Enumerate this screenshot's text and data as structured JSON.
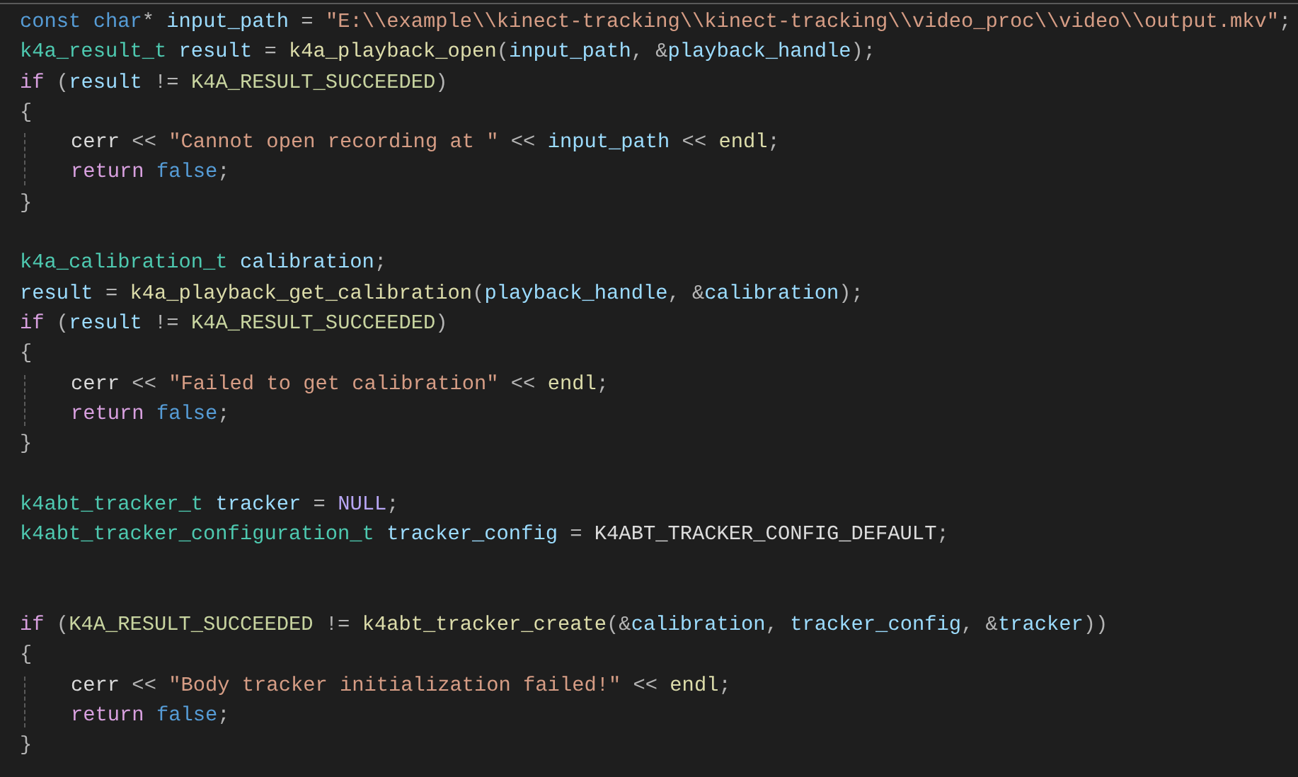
{
  "editor": {
    "lines": [
      {
        "kind": "code",
        "tokens": [
          {
            "text": "const ",
            "kind": "keyword"
          },
          {
            "text": "char",
            "kind": "keyword"
          },
          {
            "text": "* ",
            "kind": "op"
          },
          {
            "text": "input_path",
            "kind": "variable"
          },
          {
            "text": " = ",
            "kind": "op"
          },
          {
            "text": "\"E:\\\\example\\\\kinect-tracking\\\\kinect-tracking\\\\video_proc\\\\video\\\\output.mkv\"",
            "kind": "string"
          },
          {
            "text": ";",
            "kind": "op"
          }
        ]
      },
      {
        "kind": "code",
        "tokens": [
          {
            "text": "k4a_result_t ",
            "kind": "type"
          },
          {
            "text": "result",
            "kind": "variable"
          },
          {
            "text": " = ",
            "kind": "op"
          },
          {
            "text": "k4a_playback_open",
            "kind": "function"
          },
          {
            "text": "(",
            "kind": "op"
          },
          {
            "text": "input_path",
            "kind": "variable"
          },
          {
            "text": ", &",
            "kind": "op"
          },
          {
            "text": "playback_handle",
            "kind": "variable"
          },
          {
            "text": ");",
            "kind": "op"
          }
        ]
      },
      {
        "kind": "code",
        "tokens": [
          {
            "text": "if",
            "kind": "control"
          },
          {
            "text": " (",
            "kind": "op"
          },
          {
            "text": "result",
            "kind": "variable"
          },
          {
            "text": " != ",
            "kind": "op"
          },
          {
            "text": "K4A_RESULT_SUCCEEDED",
            "kind": "macro"
          },
          {
            "text": ")",
            "kind": "op"
          }
        ]
      },
      {
        "kind": "code",
        "tokens": [
          {
            "text": "{",
            "kind": "op"
          }
        ],
        "children": [
          {
            "kind": "code",
            "tokens": [
              {
                "text": "cerr",
                "kind": "identifier"
              },
              {
                "text": " << ",
                "kind": "op"
              },
              {
                "text": "\"Cannot open recording at \"",
                "kind": "string"
              },
              {
                "text": " << ",
                "kind": "op"
              },
              {
                "text": "input_path",
                "kind": "variable"
              },
              {
                "text": " << ",
                "kind": "op"
              },
              {
                "text": "endl",
                "kind": "function"
              },
              {
                "text": ";",
                "kind": "op"
              }
            ]
          },
          {
            "kind": "code",
            "tokens": [
              {
                "text": "return ",
                "kind": "control"
              },
              {
                "text": "false",
                "kind": "keyword"
              },
              {
                "text": ";",
                "kind": "op"
              }
            ]
          }
        ]
      },
      {
        "kind": "code",
        "tokens": [
          {
            "text": "}",
            "kind": "op"
          }
        ]
      },
      {
        "kind": "blank"
      },
      {
        "kind": "code",
        "tokens": [
          {
            "text": "k4a_calibration_t ",
            "kind": "type"
          },
          {
            "text": "calibration",
            "kind": "variable"
          },
          {
            "text": ";",
            "kind": "op"
          }
        ]
      },
      {
        "kind": "code",
        "tokens": [
          {
            "text": "result",
            "kind": "variable"
          },
          {
            "text": " = ",
            "kind": "op"
          },
          {
            "text": "k4a_playback_get_calibration",
            "kind": "function"
          },
          {
            "text": "(",
            "kind": "op"
          },
          {
            "text": "playback_handle",
            "kind": "variable"
          },
          {
            "text": ", &",
            "kind": "op"
          },
          {
            "text": "calibration",
            "kind": "variable"
          },
          {
            "text": ");",
            "kind": "op"
          }
        ]
      },
      {
        "kind": "code",
        "tokens": [
          {
            "text": "if",
            "kind": "control"
          },
          {
            "text": " (",
            "kind": "op"
          },
          {
            "text": "result",
            "kind": "variable"
          },
          {
            "text": " != ",
            "kind": "op"
          },
          {
            "text": "K4A_RESULT_SUCCEEDED",
            "kind": "macro"
          },
          {
            "text": ")",
            "kind": "op"
          }
        ]
      },
      {
        "kind": "code",
        "tokens": [
          {
            "text": "{",
            "kind": "op"
          }
        ],
        "children": [
          {
            "kind": "code",
            "tokens": [
              {
                "text": "cerr",
                "kind": "identifier"
              },
              {
                "text": " << ",
                "kind": "op"
              },
              {
                "text": "\"Failed to get calibration\"",
                "kind": "string"
              },
              {
                "text": " << ",
                "kind": "op"
              },
              {
                "text": "endl",
                "kind": "function"
              },
              {
                "text": ";",
                "kind": "op"
              }
            ]
          },
          {
            "kind": "code",
            "tokens": [
              {
                "text": "return ",
                "kind": "control"
              },
              {
                "text": "false",
                "kind": "keyword"
              },
              {
                "text": ";",
                "kind": "op"
              }
            ]
          }
        ]
      },
      {
        "kind": "code",
        "tokens": [
          {
            "text": "}",
            "kind": "op"
          }
        ]
      },
      {
        "kind": "blank"
      },
      {
        "kind": "code",
        "tokens": [
          {
            "text": "k4abt_tracker_t ",
            "kind": "type"
          },
          {
            "text": "tracker",
            "kind": "variable"
          },
          {
            "text": " = ",
            "kind": "op"
          },
          {
            "text": "NULL",
            "kind": "null"
          },
          {
            "text": ";",
            "kind": "op"
          }
        ]
      },
      {
        "kind": "code",
        "tokens": [
          {
            "text": "k4abt_tracker_configuration_t ",
            "kind": "type"
          },
          {
            "text": "tracker_config",
            "kind": "variable"
          },
          {
            "text": " = ",
            "kind": "op"
          },
          {
            "text": "K4ABT_TRACKER_CONFIG_DEFAULT",
            "kind": "constant"
          },
          {
            "text": ";",
            "kind": "op"
          }
        ]
      },
      {
        "kind": "blank"
      },
      {
        "kind": "blank"
      },
      {
        "kind": "code",
        "tokens": [
          {
            "text": "if",
            "kind": "control"
          },
          {
            "text": " (",
            "kind": "op"
          },
          {
            "text": "K4A_RESULT_SUCCEEDED",
            "kind": "macro"
          },
          {
            "text": " != ",
            "kind": "op"
          },
          {
            "text": "k4abt_tracker_create",
            "kind": "function"
          },
          {
            "text": "(&",
            "kind": "op"
          },
          {
            "text": "calibration",
            "kind": "variable"
          },
          {
            "text": ", ",
            "kind": "op"
          },
          {
            "text": "tracker_config",
            "kind": "variable"
          },
          {
            "text": ", &",
            "kind": "op"
          },
          {
            "text": "tracker",
            "kind": "variable"
          },
          {
            "text": "))",
            "kind": "op"
          }
        ]
      },
      {
        "kind": "code",
        "tokens": [
          {
            "text": "{",
            "kind": "op"
          }
        ],
        "children": [
          {
            "kind": "code",
            "tokens": [
              {
                "text": "cerr",
                "kind": "identifier"
              },
              {
                "text": " << ",
                "kind": "op"
              },
              {
                "text": "\"Body tracker initialization failed!\"",
                "kind": "string"
              },
              {
                "text": " << ",
                "kind": "op"
              },
              {
                "text": "endl",
                "kind": "function"
              },
              {
                "text": ";",
                "kind": "op"
              }
            ]
          },
          {
            "kind": "code",
            "tokens": [
              {
                "text": "return ",
                "kind": "control"
              },
              {
                "text": "false",
                "kind": "keyword"
              },
              {
                "text": ";",
                "kind": "op"
              }
            ]
          }
        ]
      },
      {
        "kind": "code",
        "tokens": [
          {
            "text": "}",
            "kind": "op"
          }
        ]
      }
    ]
  }
}
